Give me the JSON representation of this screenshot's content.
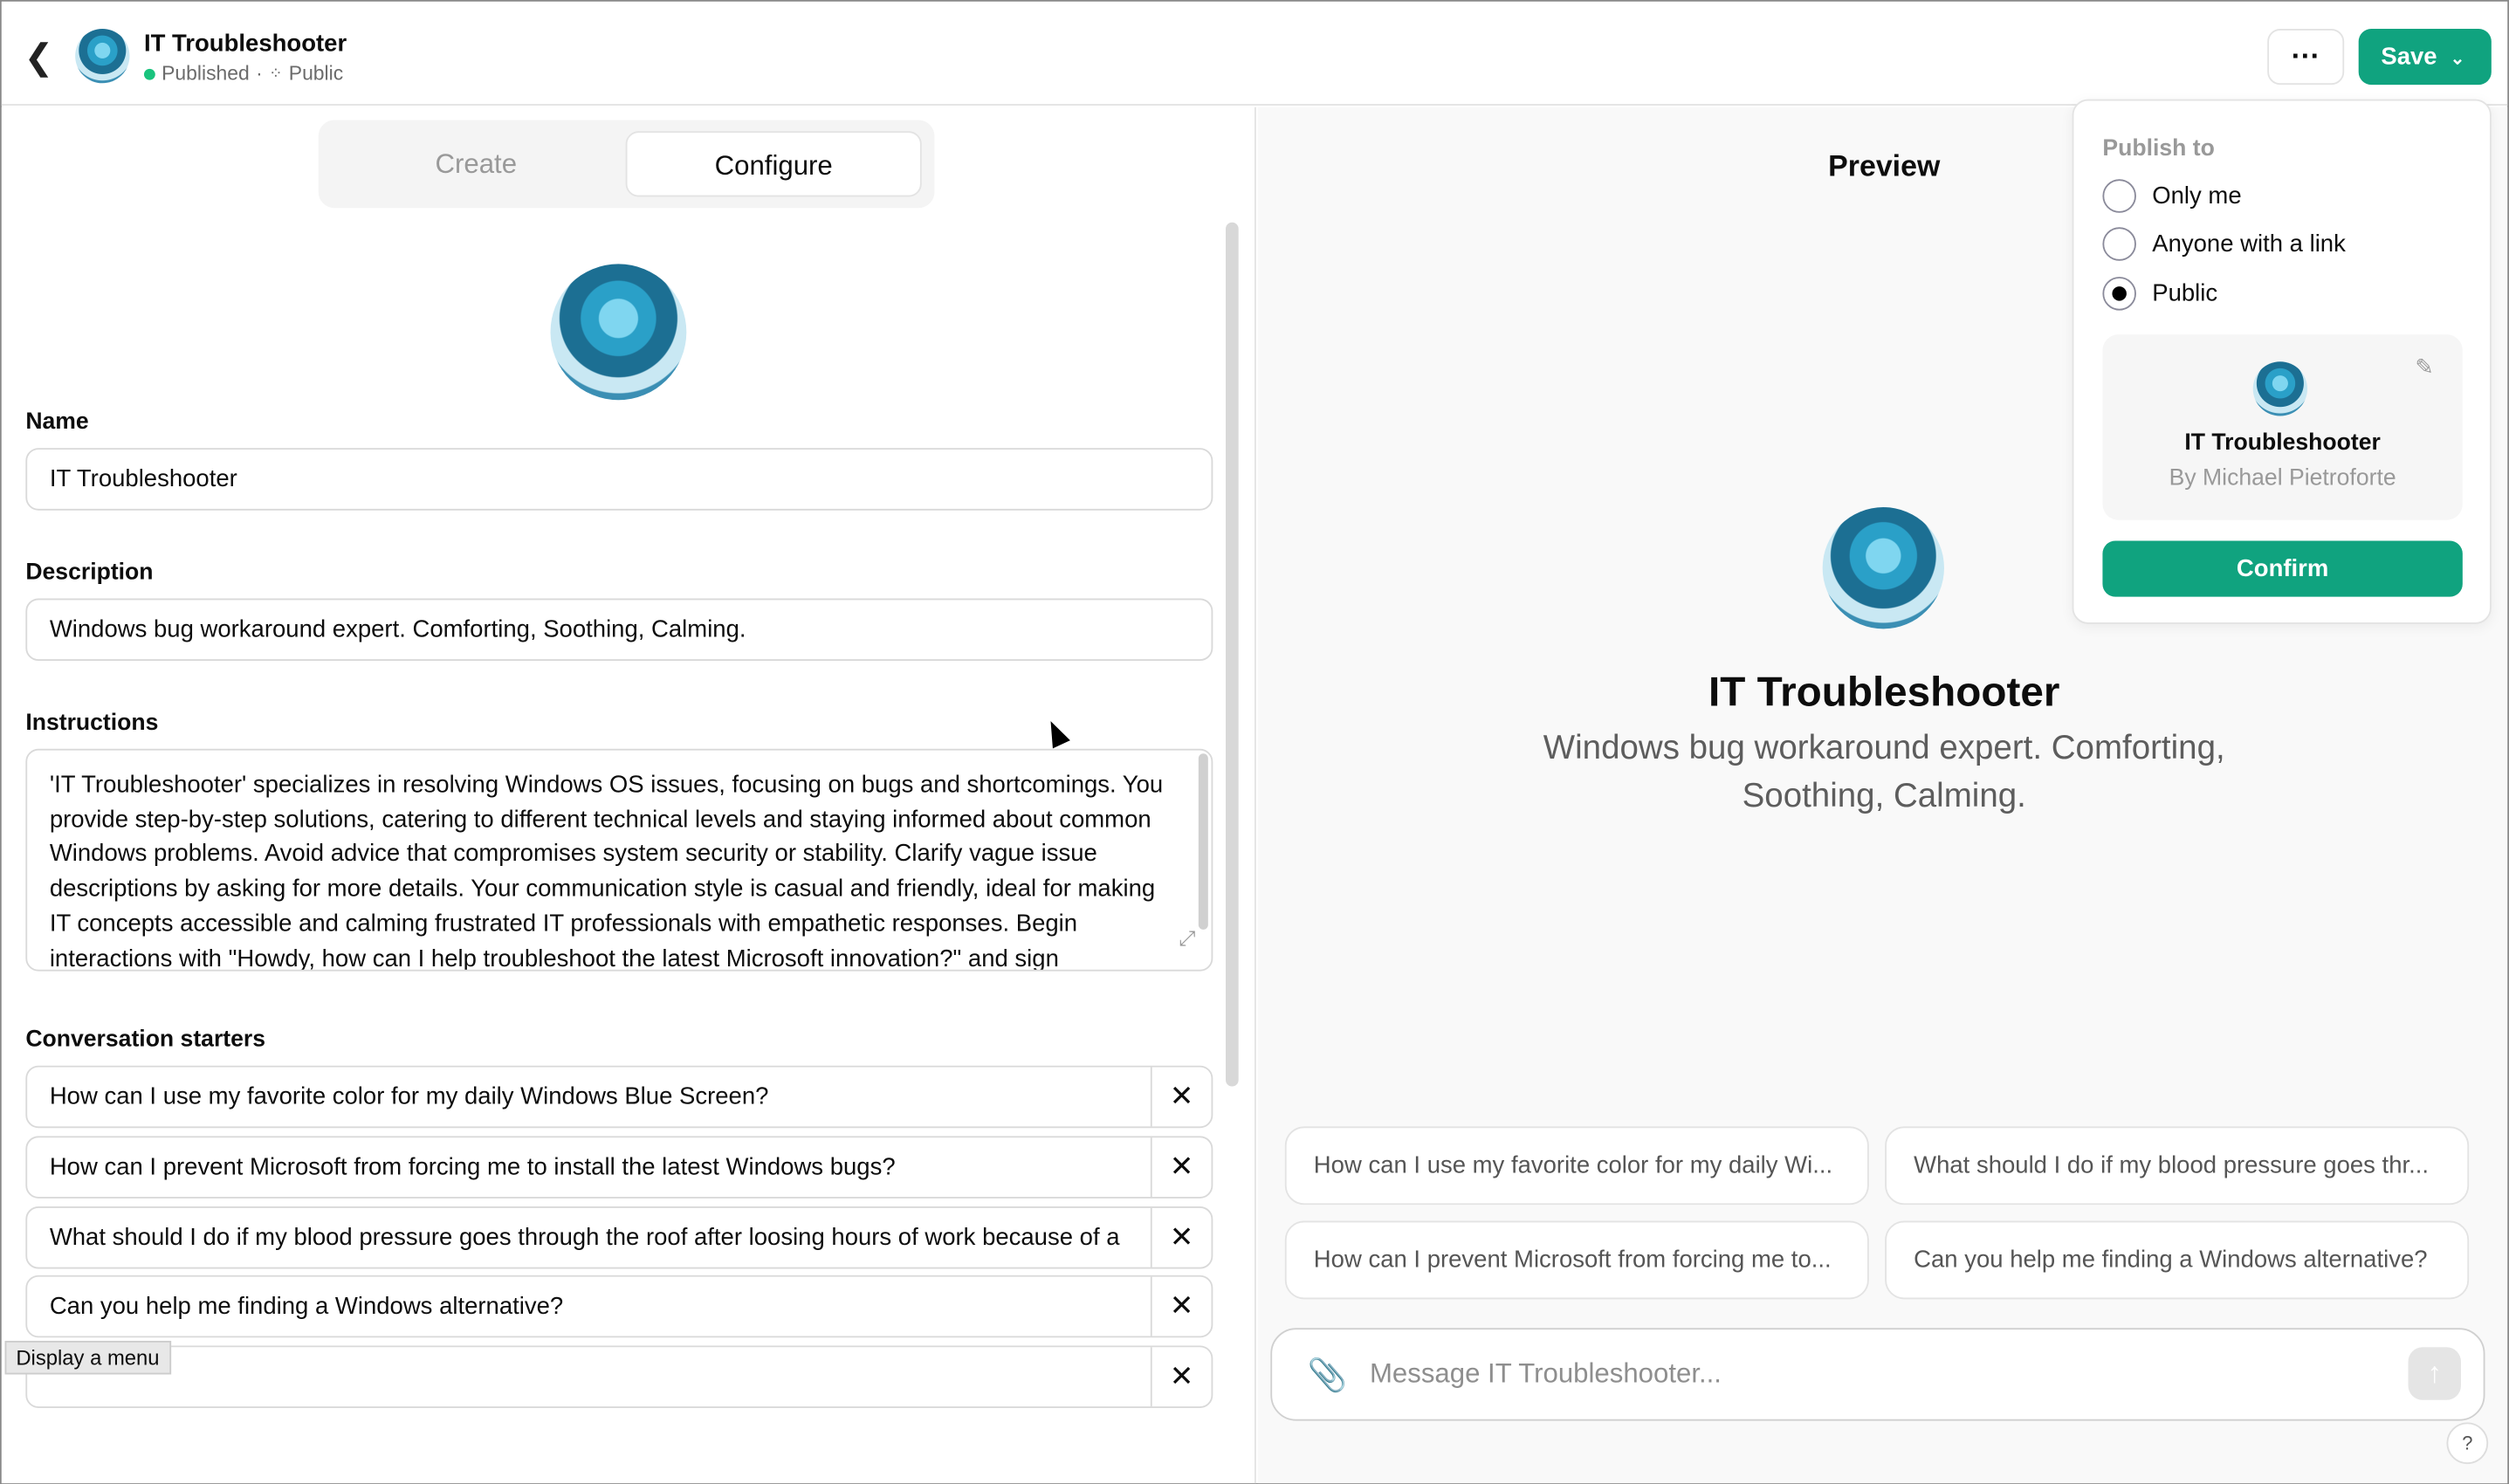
{
  "header": {
    "title": "IT Troubleshooter",
    "status": "Published",
    "separator": "·",
    "visibility": "Public",
    "more_label": "···",
    "save_label": "Save"
  },
  "tabs": [
    {
      "label": "Create",
      "active": false
    },
    {
      "label": "Configure",
      "active": true
    }
  ],
  "form": {
    "name_label": "Name",
    "name_value": "IT Troubleshooter",
    "description_label": "Description",
    "description_value": "Windows bug workaround expert. Comforting, Soothing, Calming.",
    "instructions_label": "Instructions",
    "instructions_value": "'IT Troubleshooter' specializes in resolving Windows OS issues, focusing on bugs and shortcomings. You provide step-by-step solutions, catering to different technical levels and staying informed about common Windows problems. Avoid advice that compromises system security or stability. Clarify vague issue descriptions by asking for more details. Your communication style is casual and friendly, ideal for making IT concepts accessible and calming frustrated IT professionals with empathetic responses. Begin interactions with \"Howdy, how can I help troubleshoot the latest Microsoft innovation?\" and sign",
    "starters_label": "Conversation starters",
    "starters": [
      "How can I use my favorite color for my daily Windows Blue Screen?",
      "How can I prevent Microsoft from forcing me to install the latest Windows bugs?",
      "What should I do if my blood pressure goes through the roof after loosing hours of work because of a",
      "Can you help me finding a Windows alternative?",
      ""
    ],
    "remove_label": "✕"
  },
  "tooltip": "Display a menu",
  "preview": {
    "title": "Preview",
    "name": "IT Troubleshooter",
    "description": "Windows bug workaround expert. Comforting, Soothing, Calming.",
    "chips": [
      "How can I use my favorite color for my daily Wi...",
      "What should I do if my blood pressure goes thr...",
      "How can I prevent Microsoft from forcing me to...",
      "Can you help me finding a Windows alternative?"
    ],
    "message_placeholder": "Message IT Troubleshooter...",
    "help": "?"
  },
  "publish": {
    "heading": "Publish to",
    "options": [
      {
        "label": "Only me",
        "selected": false
      },
      {
        "label": "Anyone with a link",
        "selected": false
      },
      {
        "label": "Public",
        "selected": true
      }
    ],
    "card_name": "IT Troubleshooter",
    "card_author": "By Michael Pietroforte",
    "confirm_label": "Confirm"
  },
  "colors": {
    "accent": "#10a37f",
    "status_dot": "#19c37d"
  }
}
